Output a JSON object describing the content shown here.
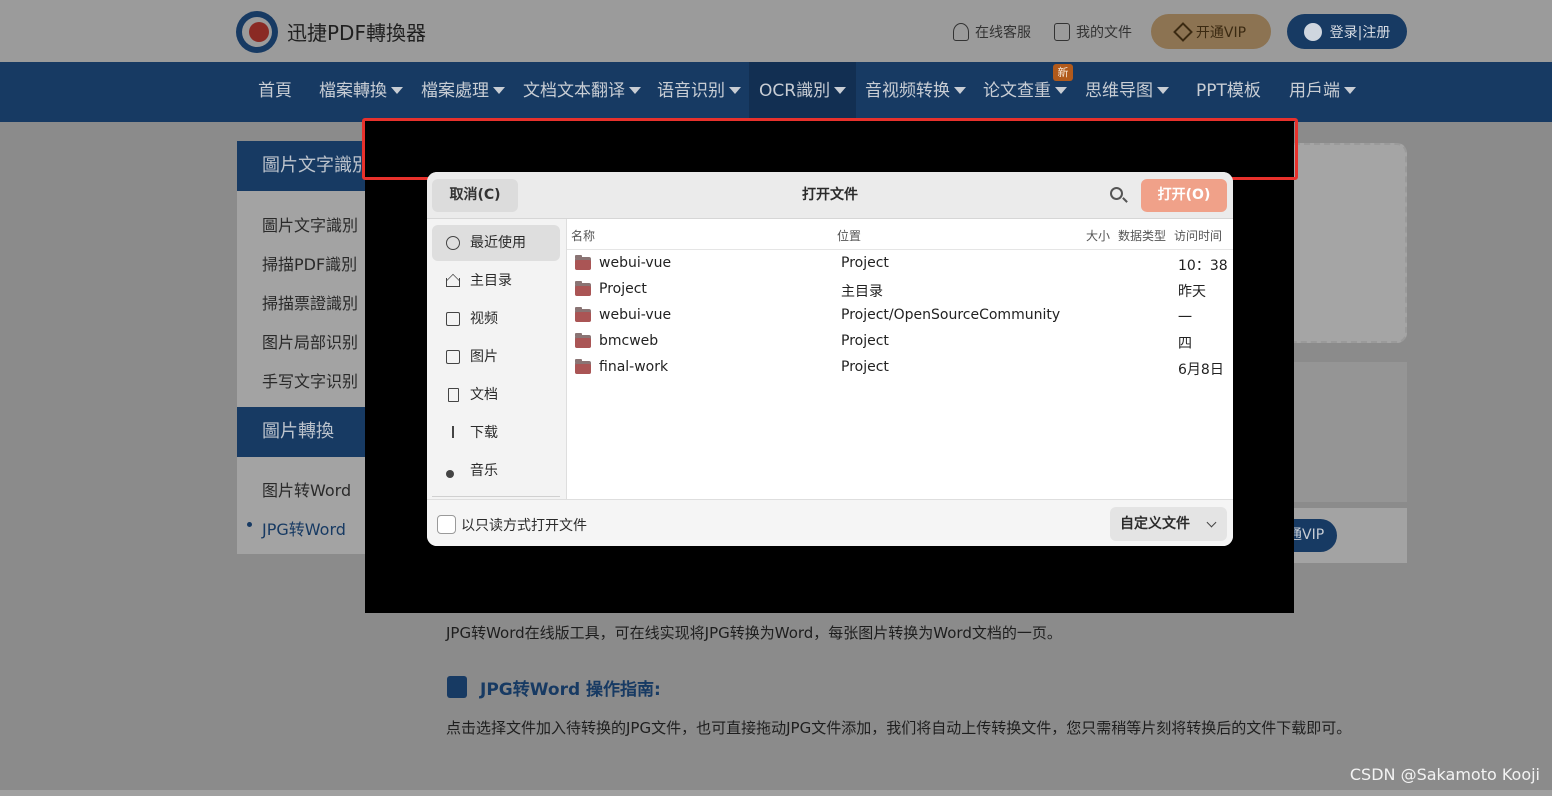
{
  "header": {
    "brand": "迅捷PDF轉換器",
    "service_label": "在线客服",
    "myfiles_label": "我的文件",
    "vip_label": "开通VIP",
    "login_label": "登录|注册"
  },
  "nav": {
    "items": [
      {
        "label": "首頁"
      },
      {
        "label": "檔案轉換"
      },
      {
        "label": "檔案處理"
      },
      {
        "label": "文档文本翻译"
      },
      {
        "label": "语音识别"
      },
      {
        "label": "OCR識別"
      },
      {
        "label": "音视频转换"
      },
      {
        "label": "论文查重"
      },
      {
        "label": "思维导图"
      },
      {
        "label": "PPT模板"
      },
      {
        "label": "用戶端"
      }
    ],
    "new_badge": "新"
  },
  "sidebar": {
    "section1_title": "圖片文字識別",
    "section1_items": [
      "圖片文字識別",
      "掃描PDF識別",
      "掃描票證識別",
      "图片局部识别",
      "手写文字识别"
    ],
    "section2_title": "圖片轉換",
    "section2_items": [
      "图片转Word",
      "JPG转Word"
    ]
  },
  "main": {
    "vip_pill": "通VIP",
    "description": "JPG转Word在线版工具，可在线实现将JPG转换为Word，每张图片转换为Word文档的一页。",
    "guide_title": "JPG转Word 操作指南:",
    "guide_text": "点击选择文件加入待转换的JPG文件，也可直接拖动JPG文件添加，我们将自动上传转换文件，您只需稍等片刻将转换后的文件下载即可。"
  },
  "dialog": {
    "title": "打开文件",
    "cancel_label": "取消(C)",
    "open_label": "打开(O)",
    "places": [
      {
        "label": "最近使用",
        "icon": "clock-icon"
      },
      {
        "label": "主目录",
        "icon": "home-icon"
      },
      {
        "label": "视频",
        "icon": "video-icon"
      },
      {
        "label": "图片",
        "icon": "image-icon"
      },
      {
        "label": "文档",
        "icon": "document-icon"
      },
      {
        "label": "下载",
        "icon": "download-icon"
      },
      {
        "label": "音乐",
        "icon": "music-icon"
      }
    ],
    "columns": {
      "name": "名称",
      "location": "位置",
      "size": "大小",
      "type": "数据类型",
      "access": "访问时间"
    },
    "files": [
      {
        "name": "webui-vue",
        "location": "Project",
        "access": "10：38"
      },
      {
        "name": "Project",
        "location": "主目录",
        "access": "昨天"
      },
      {
        "name": "webui-vue",
        "location": "Project/OpenSourceCommunity",
        "access": "一"
      },
      {
        "name": "bmcweb",
        "location": "Project",
        "access": "四"
      },
      {
        "name": "final-work",
        "location": "Project",
        "access": "6月8日"
      }
    ],
    "readonly_label": "以只读方式打开文件",
    "filter_label": "自定义文件"
  },
  "watermark": "CSDN @Sakamoto Kooji",
  "colors": {
    "nav_bg": "#1e73c9",
    "highlight": "#e8312c",
    "open_button": "#f0a189"
  }
}
